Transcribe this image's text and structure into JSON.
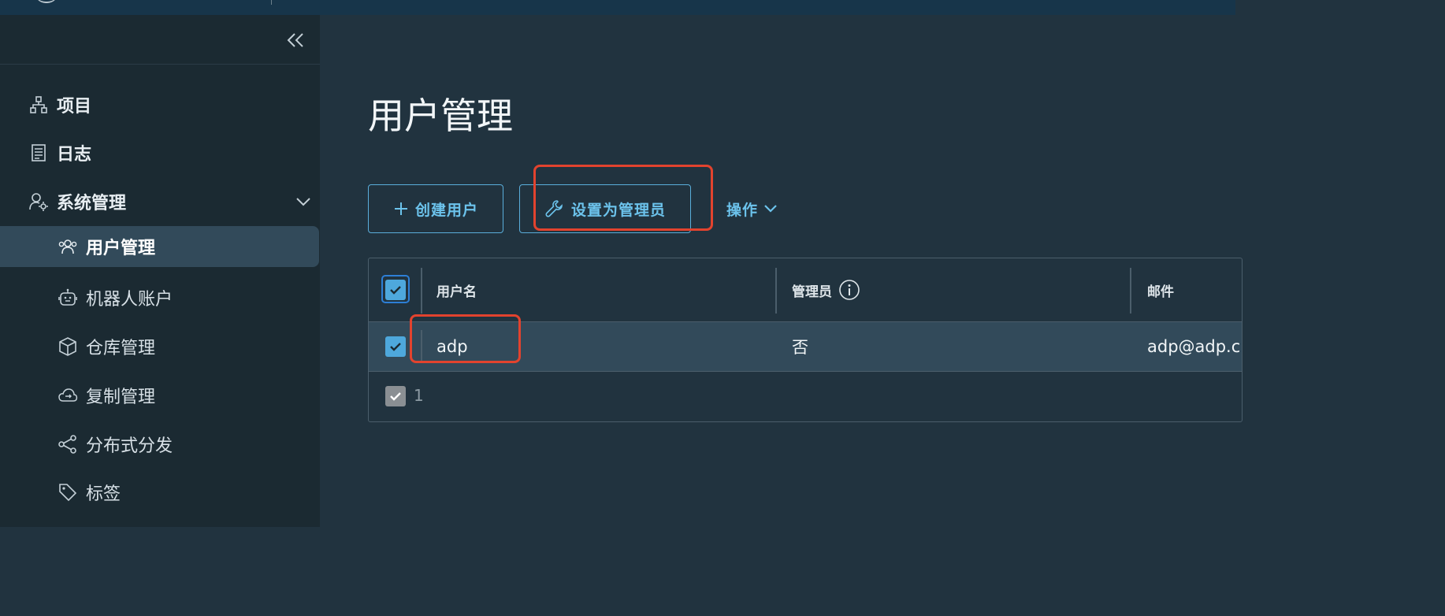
{
  "sidebar": {
    "items": [
      {
        "label": "项目",
        "icon": "project-icon"
      },
      {
        "label": "日志",
        "icon": "log-icon"
      },
      {
        "label": "系统管理",
        "icon": "user-gear-icon"
      }
    ],
    "sub_items": [
      {
        "label": "用户管理",
        "icon": "users-icon",
        "active": true
      },
      {
        "label": "机器人账户",
        "icon": "robot-icon"
      },
      {
        "label": "仓库管理",
        "icon": "cube-icon"
      },
      {
        "label": "复制管理",
        "icon": "cloud-sync-icon"
      },
      {
        "label": "分布式分发",
        "icon": "share-icon"
      },
      {
        "label": "标签",
        "icon": "tag-icon"
      }
    ]
  },
  "main": {
    "title": "用户管理",
    "toolbar": {
      "create_label": "创建用户",
      "set_admin_label": "设置为管理员",
      "actions_label": "操作"
    },
    "table": {
      "columns": [
        "用户名",
        "管理员",
        "邮件"
      ],
      "rows": [
        {
          "username": "adp",
          "admin": "否",
          "email": "adp@adp.c",
          "selected": true
        }
      ],
      "footer_count": "1"
    }
  },
  "colors": {
    "accent": "#6cc3ec",
    "highlight": "#e2432e",
    "sidebar_bg": "#1b2a32",
    "main_bg": "#21333f",
    "active_row": "#324a5a"
  }
}
